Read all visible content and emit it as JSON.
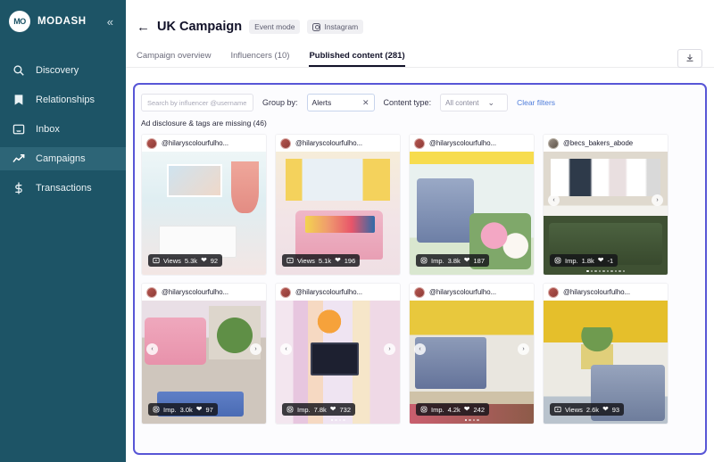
{
  "sidebar": {
    "brand": "MODASH",
    "logo_text": "MO",
    "collapse_icon": "chevrons-left-icon",
    "items": [
      {
        "label": "Discovery",
        "icon": "search-icon",
        "active": false
      },
      {
        "label": "Relationships",
        "icon": "bookmark-icon",
        "active": false
      },
      {
        "label": "Inbox",
        "icon": "inbox-icon",
        "active": false
      },
      {
        "label": "Campaigns",
        "icon": "trending-up-icon",
        "active": true
      },
      {
        "label": "Transactions",
        "icon": "dollar-icon",
        "active": false
      }
    ],
    "bg_color": "#1d5466",
    "active_bg_color": "#2d6577"
  },
  "header": {
    "back_icon": "arrow-left-icon",
    "title": "UK Campaign",
    "badges": [
      {
        "label": "Event mode",
        "icon": null
      },
      {
        "label": "Instagram",
        "icon": "instagram-icon"
      }
    ],
    "export_icon": "download-icon"
  },
  "tabs": [
    {
      "label": "Campaign overview",
      "active": false
    },
    {
      "label": "Influencers (10)",
      "active": false
    },
    {
      "label": "Published content (281)",
      "active": true
    }
  ],
  "filters": {
    "search_placeholder": "Search by influencer @username",
    "search_value": "",
    "group_by_label": "Group by:",
    "group_by_value": "Alerts",
    "group_by_clear_icon": "close-icon",
    "content_type_label": "Content type:",
    "content_type_value": "All content",
    "content_type_chevron": "chevron-down-icon",
    "clear_filters": "Clear filters",
    "panel_border_color": "#5856d6"
  },
  "group_heading": "Ad disclosure & tags are missing (46)",
  "cards": [
    {
      "handle": "@hilaryscolourfulho...",
      "metric_label": "Views",
      "metric_value": "5.3k",
      "metric_icon": "reels-icon",
      "likes": "92",
      "like_icon": "heart-icon",
      "has_arrows": false,
      "dots": 0,
      "art": "a1"
    },
    {
      "handle": "@hilaryscolourfulho...",
      "metric_label": "Views",
      "metric_value": "5.1k",
      "metric_icon": "reels-icon",
      "likes": "196",
      "like_icon": "heart-icon",
      "has_arrows": false,
      "dots": 0,
      "art": "a2"
    },
    {
      "handle": "@hilaryscolourfulho...",
      "metric_label": "Imp.",
      "metric_value": "3.8k",
      "metric_icon": "instagram-icon",
      "likes": "187",
      "like_icon": "heart-icon",
      "has_arrows": false,
      "dots": 0,
      "art": "a3"
    },
    {
      "handle": "@becs_bakers_abode",
      "metric_label": "Imp.",
      "metric_value": "1.8k",
      "metric_icon": "instagram-icon",
      "likes": "-1",
      "like_icon": "heart-icon",
      "has_arrows": true,
      "dots": 10,
      "art": "a4"
    },
    {
      "handle": "@hilaryscolourfulho...",
      "metric_label": "Imp.",
      "metric_value": "3.0k",
      "metric_icon": "instagram-icon",
      "likes": "97",
      "like_icon": "heart-icon",
      "has_arrows": true,
      "dots": 0,
      "art": "a5"
    },
    {
      "handle": "@hilaryscolourfulho...",
      "metric_label": "Imp.",
      "metric_value": "7.8k",
      "metric_icon": "instagram-icon",
      "likes": "732",
      "like_icon": "heart-icon",
      "has_arrows": true,
      "dots": 4,
      "art": "a6"
    },
    {
      "handle": "@hilaryscolourfulho...",
      "metric_label": "Imp.",
      "metric_value": "4.2k",
      "metric_icon": "instagram-icon",
      "likes": "242",
      "like_icon": "heart-icon",
      "has_arrows": true,
      "dots": 4,
      "art": "a7"
    },
    {
      "handle": "@hilaryscolourfulho...",
      "metric_label": "Views",
      "metric_value": "2.6k",
      "metric_icon": "reels-icon",
      "likes": "93",
      "like_icon": "heart-icon",
      "has_arrows": false,
      "dots": 0,
      "art": "a8"
    }
  ]
}
